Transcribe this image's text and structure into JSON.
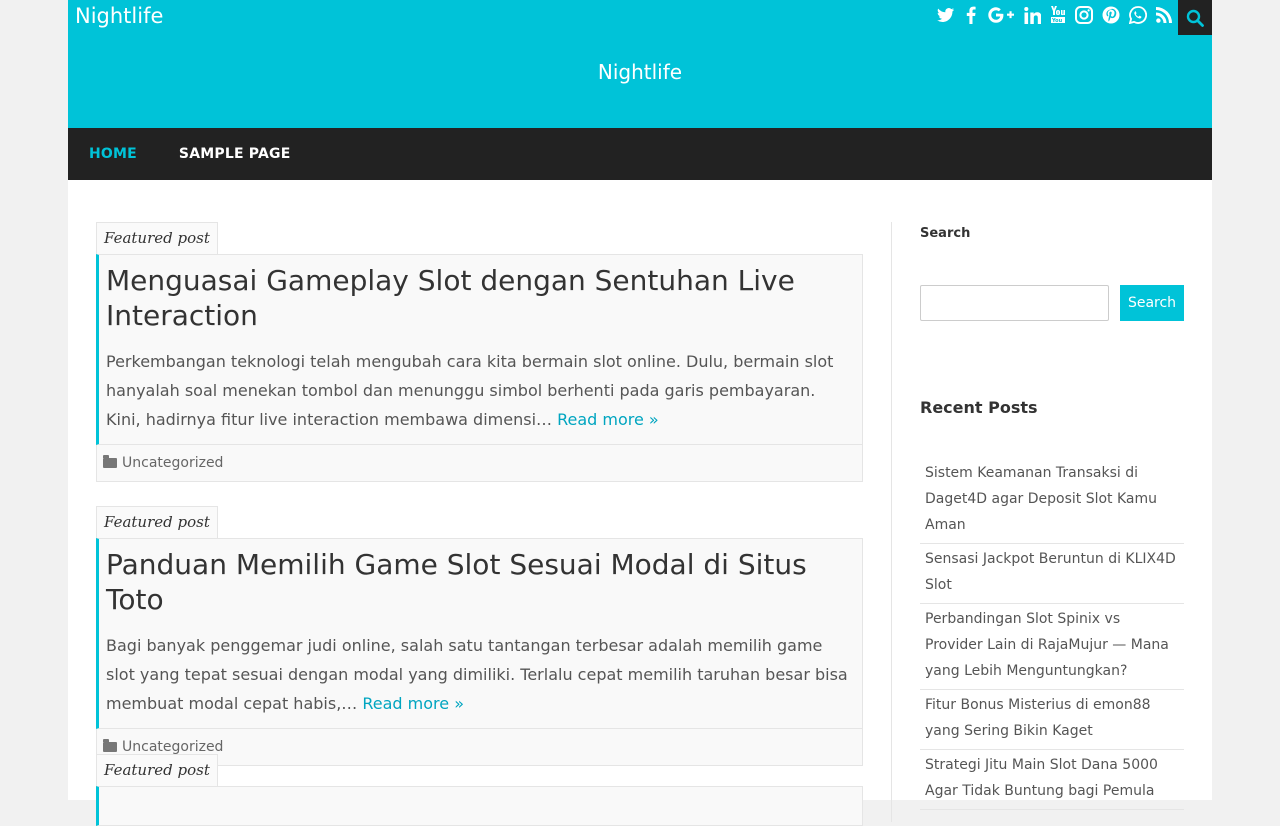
{
  "header": {
    "top_title": "Nightlife",
    "center_title": "Nightlife",
    "social_icons": [
      "twitter-icon",
      "facebook-icon",
      "google-plus-icon",
      "linkedin-icon",
      "youtube-icon",
      "instagram-icon",
      "pinterest-icon",
      "whatsapp-icon",
      "rss-icon"
    ],
    "accent_color": "#00c3d8"
  },
  "nav": {
    "items": [
      {
        "label": "Home",
        "active": true
      },
      {
        "label": "Sample Page",
        "active": false
      }
    ]
  },
  "posts": [
    {
      "badge": "Featured post",
      "title": "Menguasai Gameplay Slot dengan Sentuhan Live Interaction",
      "excerpt": "Perkembangan teknologi telah mengubah cara kita bermain slot online. Dulu, bermain slot hanyalah soal menekan tombol dan menunggu simbol berhenti pada garis pembayaran. Kini, hadirnya fitur live interaction membawa dimensi…",
      "read_more": "Read more »",
      "category": "Uncategorized"
    },
    {
      "badge": "Featured post",
      "title": "Panduan Memilih Game Slot Sesuai Modal di Situs Toto",
      "excerpt": "Bagi banyak penggemar judi online, salah satu tantangan terbesar adalah memilih game slot yang tepat sesuai dengan modal yang dimiliki. Terlalu cepat memilih taruhan besar bisa membuat modal cepat habis,…",
      "read_more": "Read more »",
      "category": "Uncategorized"
    },
    {
      "badge": "Featured post"
    }
  ],
  "sidebar": {
    "search_title": "Search",
    "search_button": "Search",
    "recent_title": "Recent Posts",
    "recent_posts": [
      "Sistem Keamanan Transaksi di Daget4D agar Deposit Slot Kamu Aman",
      "Sensasi Jackpot Beruntun di KLIX4D Slot",
      "Perbandingan Slot Spinix vs Provider Lain di RajaMujur — Mana yang Lebih Menguntungkan?",
      "Fitur Bonus Misterius di emon88 yang Sering Bikin Kaget",
      "Strategi Jitu Main Slot Dana 5000 Agar Tidak Buntung bagi Pemula"
    ]
  }
}
